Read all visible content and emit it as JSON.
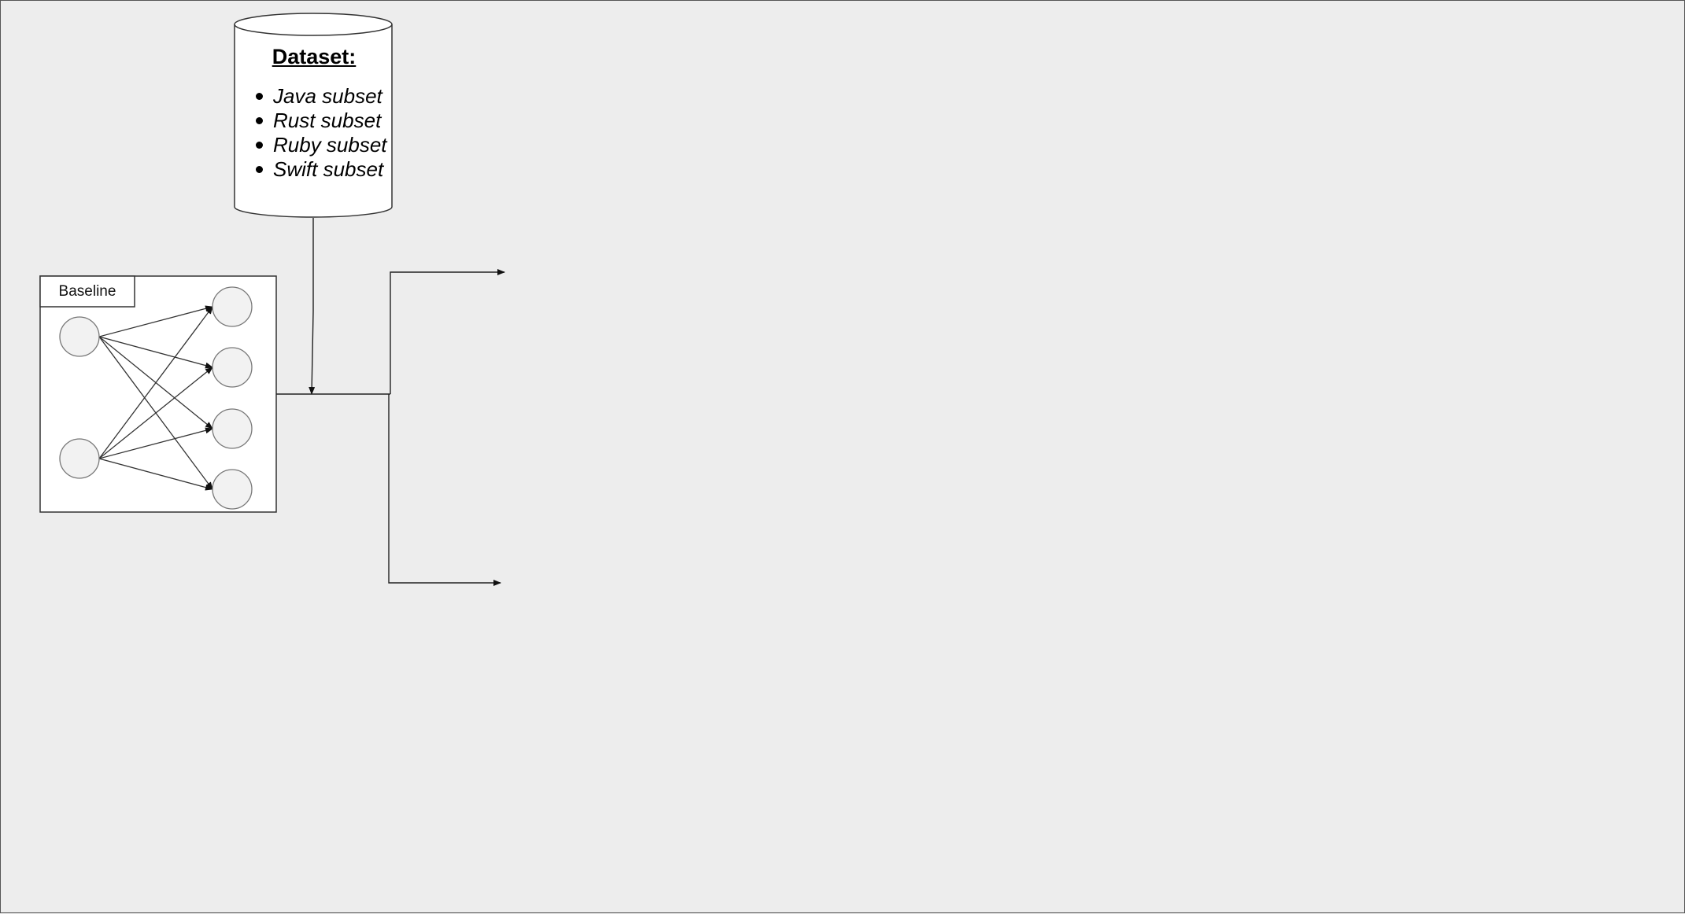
{
  "colors": {
    "background": "#ededed",
    "frame_border": "#555555",
    "shape_fill": "#ffffff",
    "node_fill": "#f2f2f2",
    "node_stroke": "#666666",
    "edge": "#222222"
  },
  "dataset": {
    "title": "Dataset:",
    "items": [
      "Java subset",
      "Rust subset",
      "Ruby subset",
      "Swift subset"
    ]
  },
  "baseline": {
    "label": "Baseline",
    "input_nodes": 2,
    "output_nodes": 4
  }
}
